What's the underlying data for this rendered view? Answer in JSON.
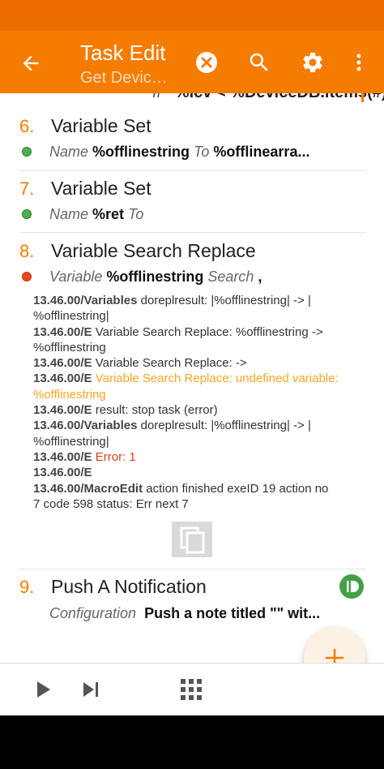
{
  "appbar": {
    "title": "Task Edit",
    "subtitle": "Get Devic…",
    "icons": [
      "back-arrow-icon",
      "cancel-icon",
      "search-icon",
      "settings-gear-icon",
      "more-vert-icon"
    ]
  },
  "partial_line": {
    "prefix": "If",
    "text": "%lcv < %DeviceDB.items(#)"
  },
  "actions": [
    {
      "number": "6.",
      "name": "Variable Set",
      "status_color": "#4caf50",
      "args": [
        {
          "label": "Name",
          "value": "%offlinestring"
        },
        {
          "label": "To",
          "value": "%offlinearra..."
        }
      ]
    },
    {
      "number": "7.",
      "name": "Variable Set",
      "status_color": "#4caf50",
      "args": [
        {
          "label": "Name",
          "value": "%ret"
        },
        {
          "label": "To",
          "value": ""
        }
      ]
    },
    {
      "number": "8.",
      "name": "Variable Search Replace",
      "status_color": "#e64a19",
      "args": [
        {
          "label": "Variable",
          "value": "%offlinestring"
        },
        {
          "label": "Search",
          "value": ","
        }
      ]
    },
    {
      "number": "9.",
      "name": "Push A Notification",
      "badge_icon": "pushbullet-d-icon",
      "args": [
        {
          "label": "Configuration",
          "value": "Push a note titled \"\" wit..."
        }
      ]
    }
  ],
  "log": {
    "line1_prefix": "13.46.00/Variables",
    "line1_text": " doreplresult: |%offlinestring| -> |",
    "line2_text": "%offlinestring|",
    "line3_prefix": "13.46.00/E",
    "line3_text": " Variable Search Replace: %offlinestring ->",
    "line4_text": "%offlinestring",
    "line5_prefix": "13.46.00/E",
    "line5_text": " Variable Search Replace:  ->",
    "line6_prefix": "13.46.00/E",
    "line6_text": " Variable Search Replace: undefined variable:",
    "line7_text": "%offlinestring",
    "line8_prefix": "13.46.00/E",
    "line8_text": " result: stop task (error)",
    "line9_prefix": "13.46.00/Variables",
    "line9_text": " doreplresult: |%offlinestring| -> |",
    "line10_text": "%offlinestring|",
    "line11_prefix": "13.46.00/E",
    "line11_text": " Error: 1",
    "line12_prefix": "13.46.00/E",
    "line13_prefix": "13.46.00/MacroEdit",
    "line13_text": " action finished exeID 19 action no",
    "line14_text": "7 code 598 status: Err next 7",
    "warn_color": "#f5a623",
    "error_color": "#d84315"
  },
  "copy_icon": "copy-icon",
  "fab": {
    "icon": "plus-icon",
    "label": "+"
  },
  "bottombar": {
    "icons": [
      "play-icon",
      "step-icon",
      "apps-grid-icon"
    ]
  },
  "colors": {
    "accent": "#f57c00",
    "statusbar": "#ec6c00"
  }
}
